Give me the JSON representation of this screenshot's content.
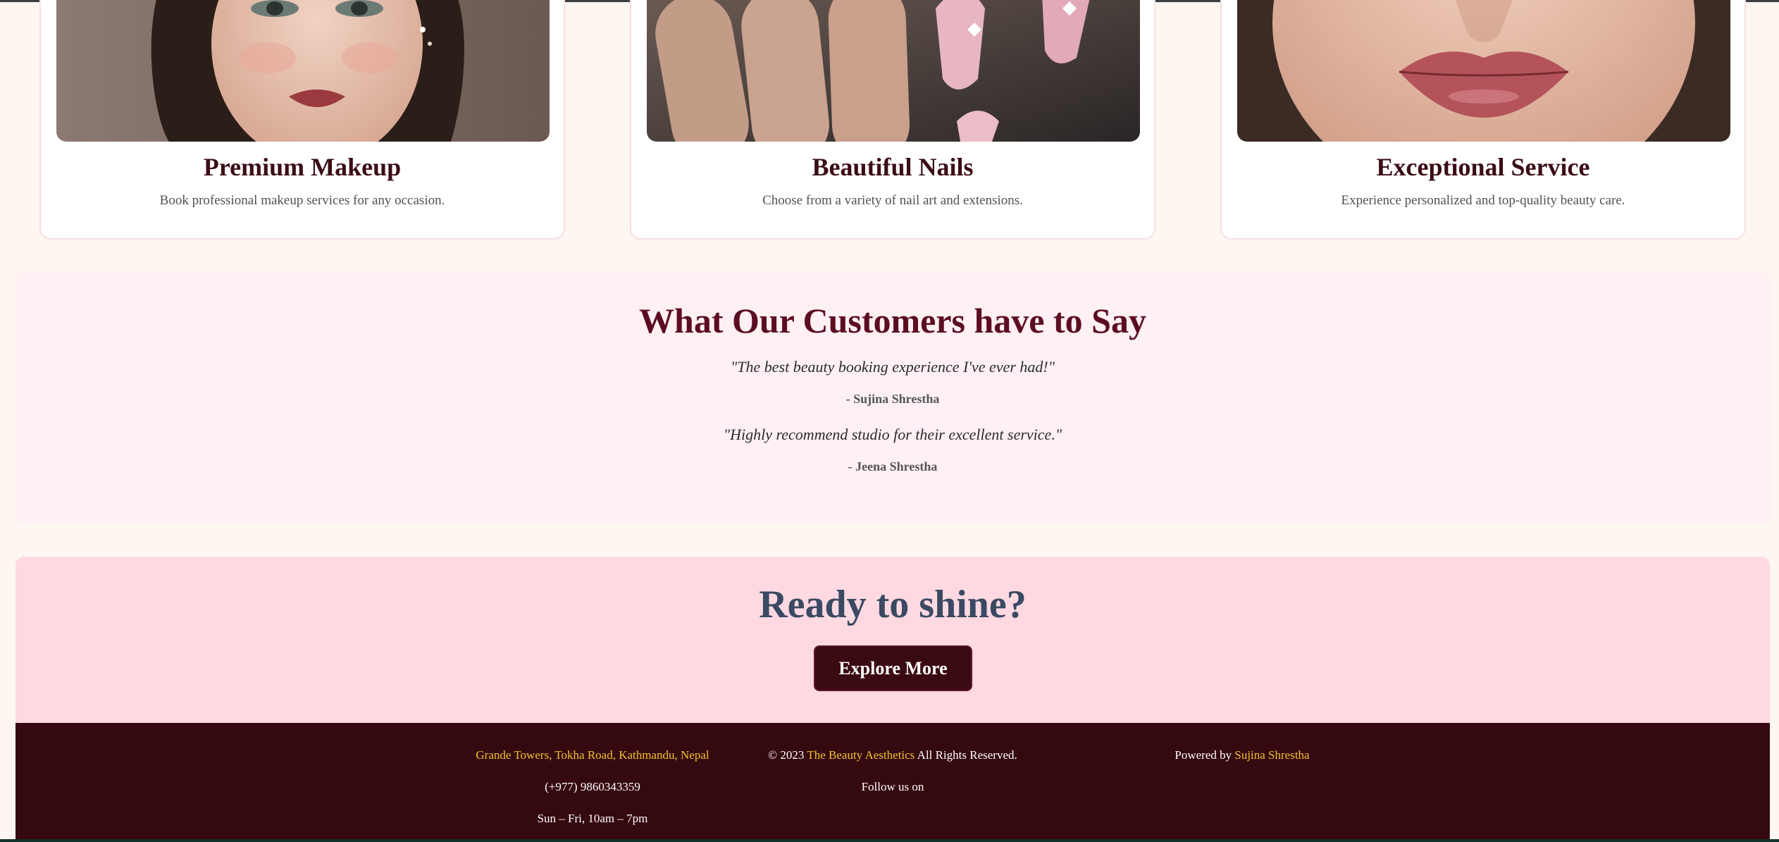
{
  "cards": [
    {
      "title": "Premium Makeup",
      "description": "Book professional makeup services for any occasion."
    },
    {
      "title": "Beautiful Nails",
      "description": "Choose from a variety of nail art and extensions."
    },
    {
      "title": "Exceptional Service",
      "description": "Experience personalized and top-quality beauty care."
    }
  ],
  "testimonials": {
    "heading": "What Our Customers have to Say",
    "items": [
      {
        "quote": "\"The best beauty booking experience I've ever had!\"",
        "author": "- Sujina Shrestha"
      },
      {
        "quote": "\"Highly recommend studio for their excellent service.\"",
        "author": "- Jeena Shrestha"
      }
    ]
  },
  "cta": {
    "heading": "Ready to shine?",
    "button_label": "Explore More"
  },
  "footer": {
    "address": "Grande Towers, Tokha Road, Kathmandu, Nepal",
    "phone": "(+977) 9860343359",
    "hours": "Sun – Fri, 10am – 7pm",
    "copyright_prefix": "© 2023",
    "brand": "The Beauty Aesthetics",
    "copyright_suffix": "All Rights Reserved.",
    "follow": "Follow us on",
    "powered_prefix": "Powered by",
    "powered_name": "Sujina Shrestha"
  },
  "colors": {
    "page_bg": "#fdf6f1",
    "maroon": "#350910",
    "heading_maroon": "#5c0d22",
    "cta_bg": "#ffd9e2",
    "testimonial_bg": "#fff0f4",
    "link_gold": "#f2c22f",
    "cta_heading": "#3a4a62"
  },
  "images": [
    "makeup-photo",
    "nails-photo",
    "lips-photo"
  ]
}
